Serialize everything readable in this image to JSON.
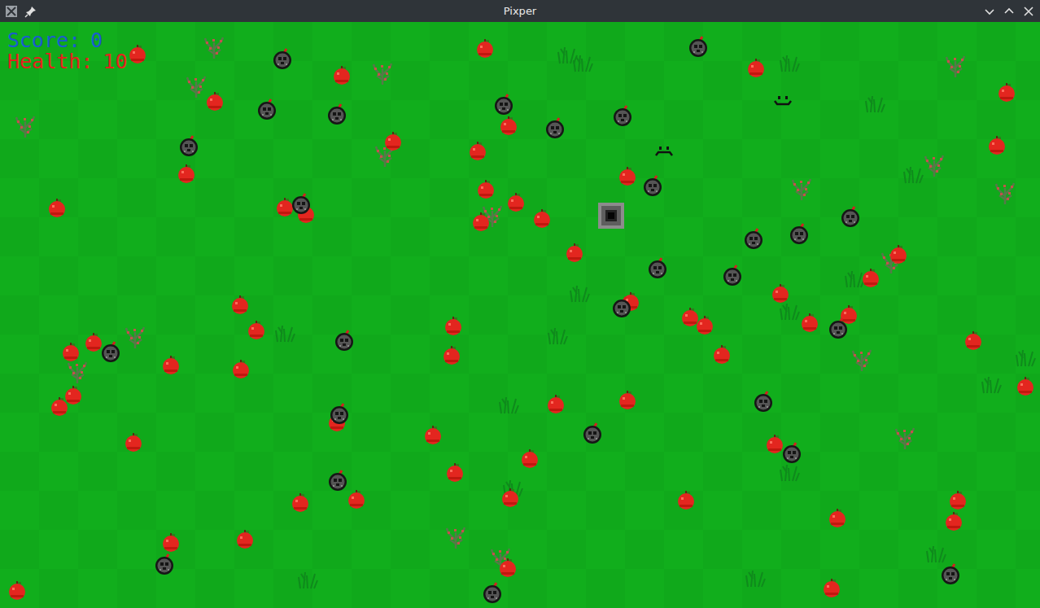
{
  "window": {
    "title": "Pixper"
  },
  "hud": {
    "score": {
      "label": "Score:",
      "value": "0"
    },
    "health": {
      "label": "Health:",
      "value": "10"
    }
  }
}
